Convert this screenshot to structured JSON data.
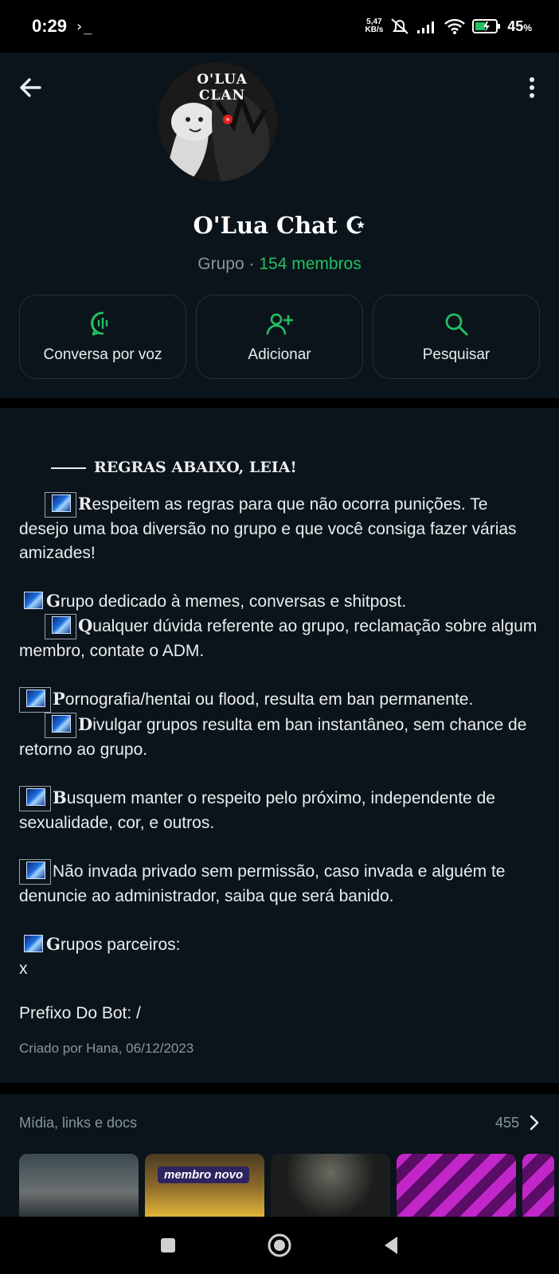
{
  "status_bar": {
    "time": "0:29",
    "terminal_glyph": "›_",
    "net_speed_value": "5,47",
    "net_speed_unit": "KB/s",
    "battery_percent": "45",
    "battery_unit": "%"
  },
  "header": {
    "avatar_text": "O'LUA CLAN",
    "group_name": "O'Lua Chat ☪",
    "group_type": "Grupo",
    "separator": "·",
    "members": "154 membros"
  },
  "actions": [
    {
      "label": "Conversa por voz",
      "icon": "voice-chat-icon"
    },
    {
      "label": "Adicionar",
      "icon": "add-person-icon"
    },
    {
      "label": "Pesquisar",
      "icon": "search-icon"
    }
  ],
  "description": {
    "title": "REGRAS ABAIXO, LEIA!",
    "p1_cap": "R",
    "p1_text": "espeitem as regras para que não ocorra punições. Te desejo uma boa diversão no grupo e que você consiga fazer várias amizades!",
    "p2a_cap": "G",
    "p2a_text": "rupo dedicado à memes, conversas e shitpost.",
    "p2b_cap": "Q",
    "p2b_text": "ualquer dúvida referente ao grupo, reclamação sobre algum membro, contate o ADM.",
    "p3a_cap": "P",
    "p3a_text": "ornografia/hentai ou flood, resulta em ban permanente.",
    "p3b_cap": "D",
    "p3b_text": "ivulgar grupos resulta em ban instantâneo, sem chance de retorno ao grupo.",
    "p4_cap": "B",
    "p4_text": "usquem manter o respeito pelo próximo, independente de sexualidade, cor, e outros.",
    "p5_text": "Não invada privado sem permissão, caso invada e alguém te denuncie ao administrador, saiba que será banido.",
    "p6_cap": "G",
    "p6_text": "rupos parceiros:",
    "p6_value": "x",
    "prefix": "Prefixo Do Bot: /",
    "created": "Criado por Hana, 06/12/2023"
  },
  "media": {
    "label": "Mídia, links e docs",
    "count": "455",
    "thumb_tag": "membro novo"
  },
  "colors": {
    "accent": "#21c063",
    "background": "#0b141a",
    "muted_text": "#8696a0"
  }
}
